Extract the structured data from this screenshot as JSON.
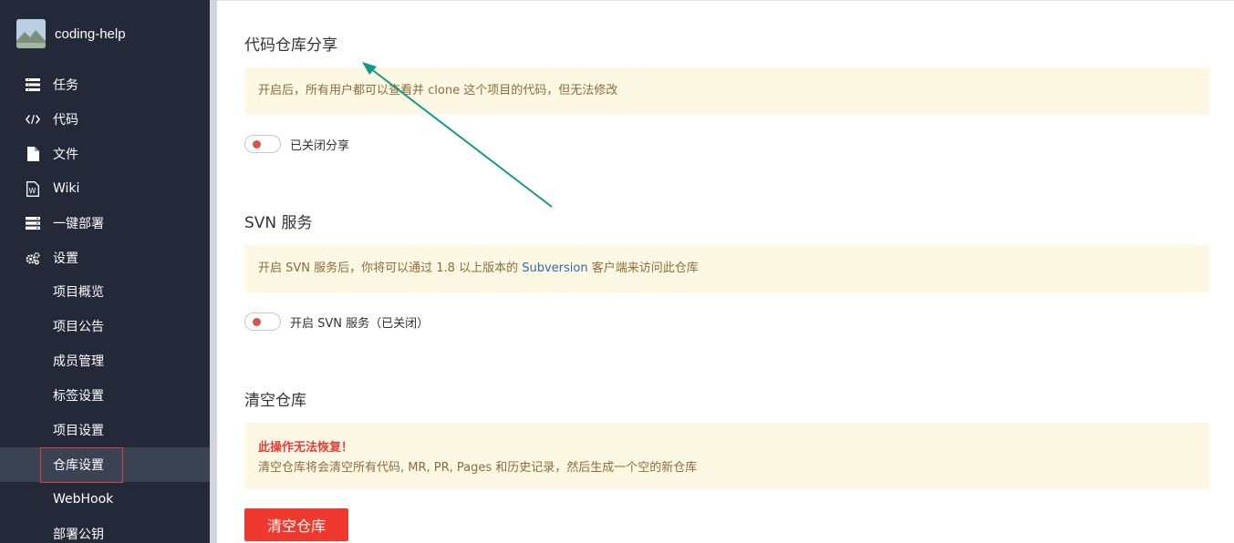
{
  "sidebar": {
    "project_name": "coding-help",
    "items": [
      {
        "label": "任务",
        "icon": "tasks-icon"
      },
      {
        "label": "代码",
        "icon": "code-icon"
      },
      {
        "label": "文件",
        "icon": "file-icon"
      },
      {
        "label": "Wiki",
        "icon": "wiki-icon"
      },
      {
        "label": "一键部署",
        "icon": "server-icon"
      },
      {
        "label": "设置",
        "icon": "gear-icon"
      }
    ],
    "sub_items": [
      {
        "label": "项目概览"
      },
      {
        "label": "项目公告"
      },
      {
        "label": "成员管理"
      },
      {
        "label": "标签设置"
      },
      {
        "label": "项目设置"
      },
      {
        "label": "仓库设置",
        "active": true
      },
      {
        "label": "WebHook"
      },
      {
        "label": "部署公钥"
      }
    ]
  },
  "sections": {
    "share": {
      "title": "代码仓库分享",
      "notice": "开启后，所有用户都可以查看并 clone 这个项目的代码，但无法修改",
      "toggle_label": "已关闭分享"
    },
    "svn": {
      "title": "SVN 服务",
      "notice_prefix": "开启 SVN 服务后，你将可以通过 1.8 以上版本的 ",
      "notice_link": "Subversion",
      "notice_suffix": " 客户端来访问此仓库",
      "toggle_label": "开启 SVN 服务（已关闭）"
    },
    "clear": {
      "title": "清空仓库",
      "warning": "此操作无法恢复！",
      "notice": "清空仓库将会清空所有代码, MR, PR, Pages 和历史记录，然后生成一个空的新仓库",
      "button_label": "清空仓库"
    }
  },
  "colors": {
    "sidebar_bg": "#24293a",
    "notice_bg": "#fcf8e3",
    "notice_text": "#8a6d3b",
    "danger": "#f0392e",
    "annotation_arrow": "#13988a"
  }
}
